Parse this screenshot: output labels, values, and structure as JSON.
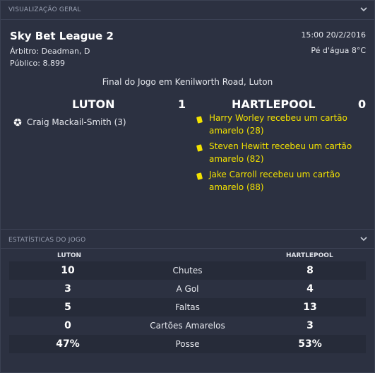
{
  "overview": {
    "header": "VISUALIZAÇÃO GERAL",
    "league": "Sky Bet League 2",
    "referee": "Árbitro: Deadman, D",
    "attendance": "Público: 8.899",
    "datetime": "15:00 20/2/2016",
    "weather": "Pé d'água 8°C",
    "venue_text": "Final do Jogo em Kenilworth Road, Luton",
    "home_team": "LUTON",
    "home_score": "1",
    "away_team": "HARTLEPOOL",
    "away_score": "0",
    "home_events": [
      {
        "icon": "ball-icon",
        "text": "Craig Mackail-Smith (3)"
      }
    ],
    "away_events": [
      {
        "icon": "yellow-card-icon",
        "line1": "Harry Worley recebeu um cartão",
        "line2": "amarelo (28)"
      },
      {
        "icon": "yellow-card-icon",
        "line1": "Steven Hewitt recebeu um cartão",
        "line2": "amarelo (82)"
      },
      {
        "icon": "yellow-card-icon",
        "line1": "Jake Carroll recebeu um cartão",
        "line2": "amarelo (88)"
      }
    ]
  },
  "stats": {
    "header": "ESTATÍSTICAS DO JOGO",
    "home_label": "LUTON",
    "away_label": "HARTLEPOOL",
    "rows": [
      {
        "home": "10",
        "label": "Chutes",
        "away": "8"
      },
      {
        "home": "3",
        "label": "A Gol",
        "away": "4"
      },
      {
        "home": "5",
        "label": "Faltas",
        "away": "13"
      },
      {
        "home": "0",
        "label": "Cartões Amarelos",
        "away": "3"
      },
      {
        "home": "47%",
        "label": "Posse",
        "away": "53%"
      }
    ]
  },
  "colors": {
    "background": "#2c3141",
    "card_yellow": "#f3e200",
    "header_text": "#9aa1b3"
  }
}
